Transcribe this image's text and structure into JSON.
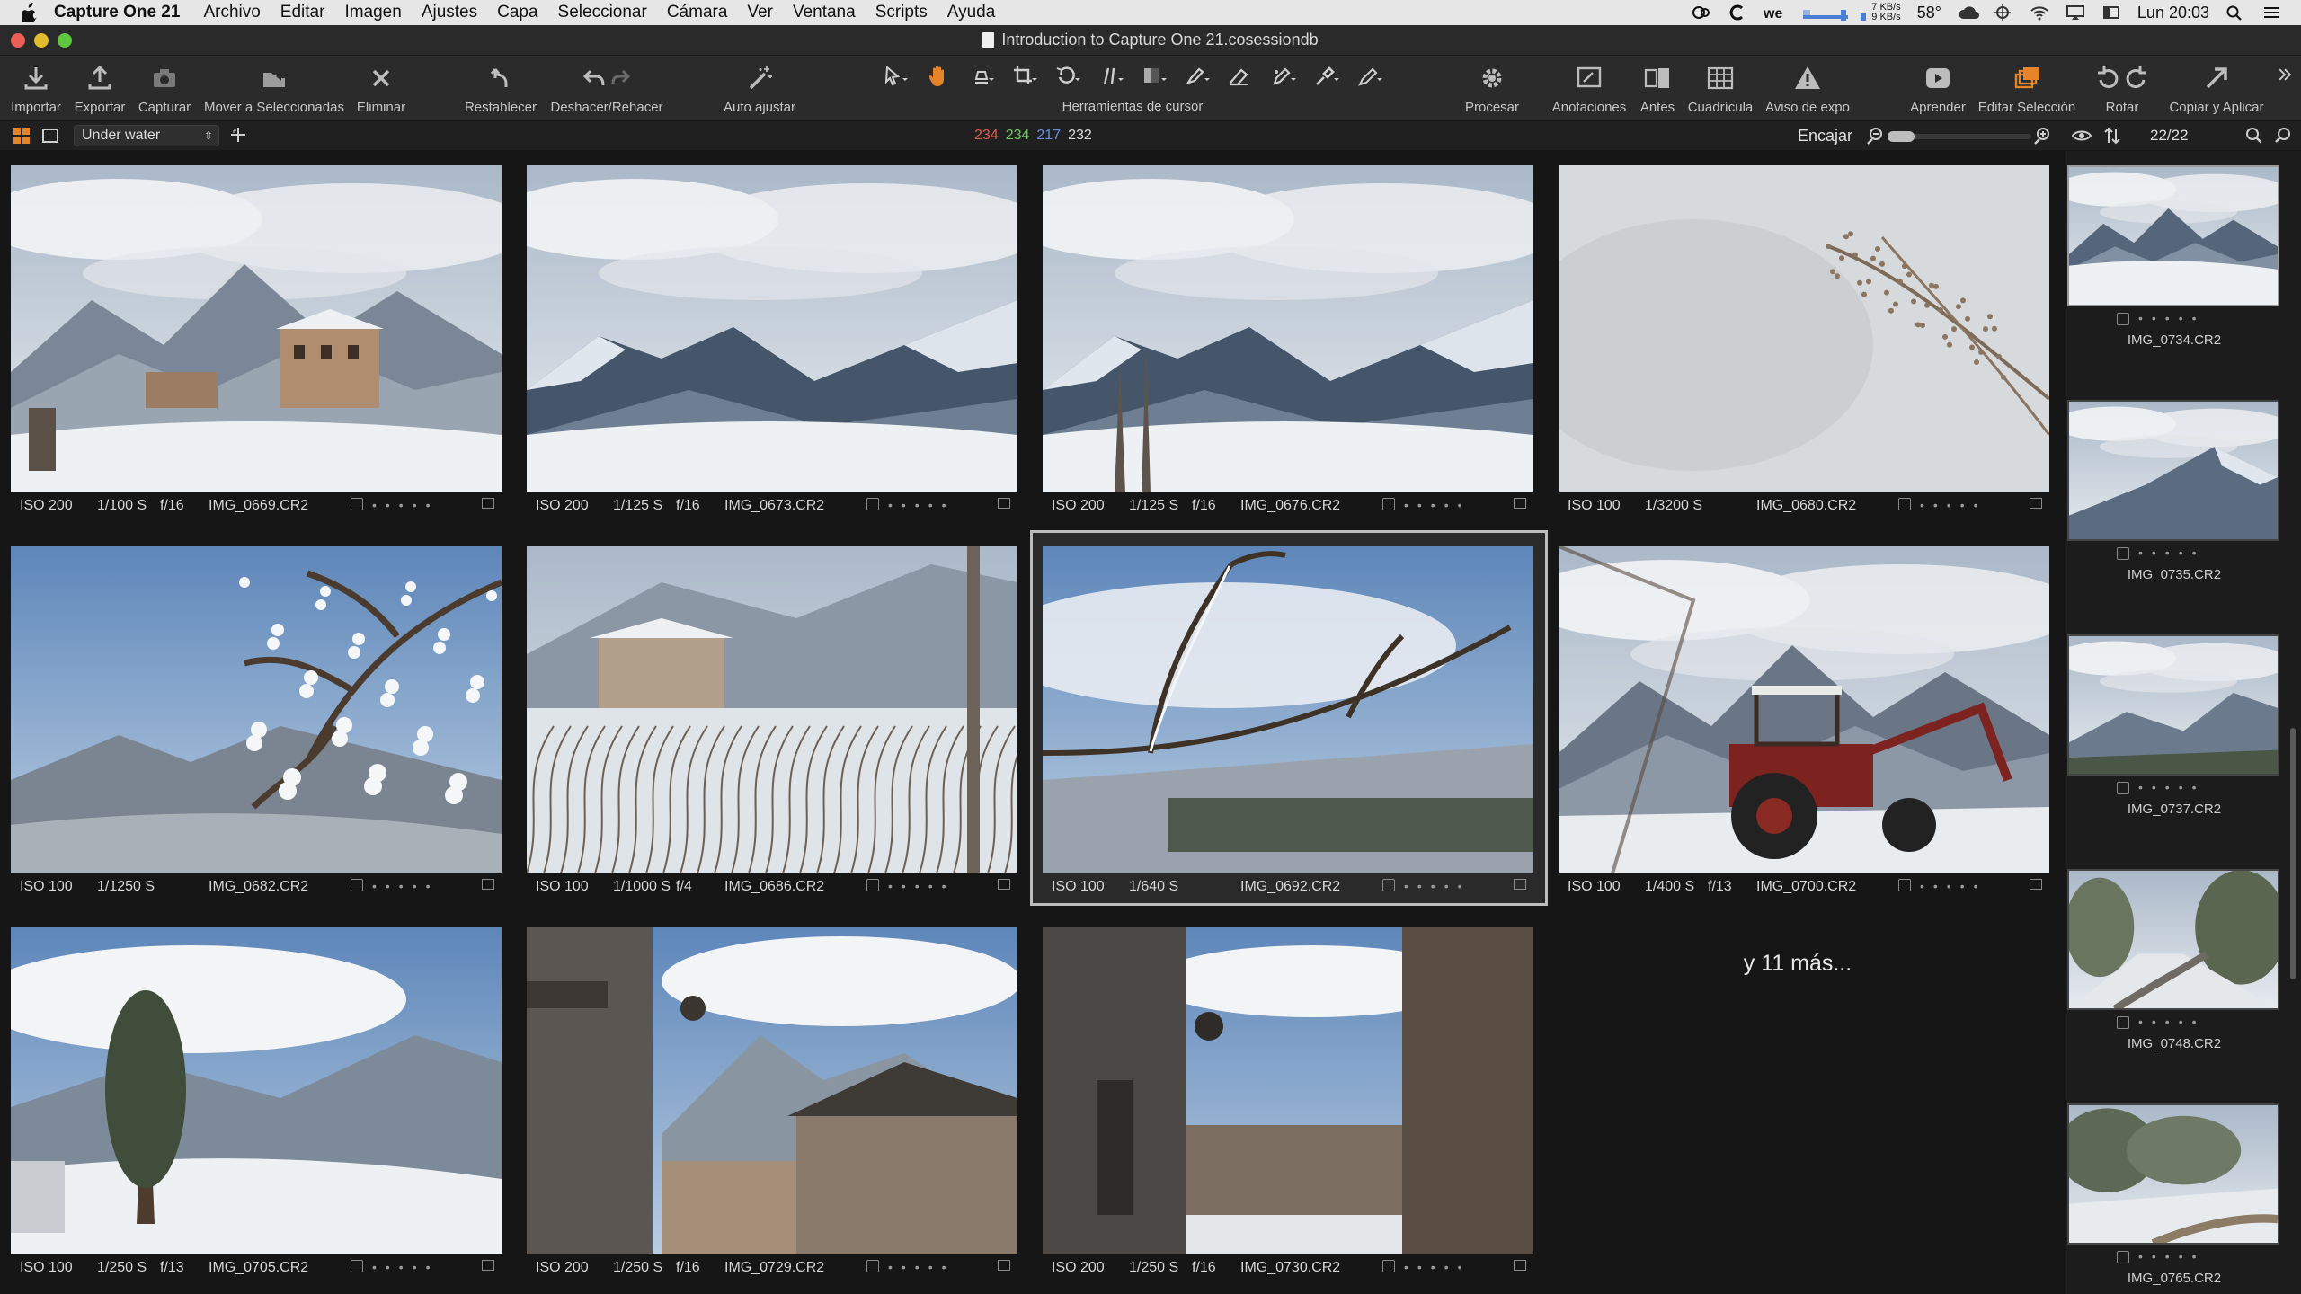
{
  "menubar": {
    "app": "Capture One 21",
    "items": [
      "Archivo",
      "Editar",
      "Imagen",
      "Ajustes",
      "Capa",
      "Seleccionar",
      "Cámara",
      "Ver",
      "Ventana",
      "Scripts",
      "Ayuda"
    ],
    "net_up": "7 KB/s",
    "net_down": "9 KB/s",
    "temp": "58°",
    "clock": "Lun 20:03"
  },
  "window": {
    "title": "Introduction to Capture One 21.cosessiondb"
  },
  "toolbar": {
    "import": "Importar",
    "export": "Exportar",
    "capture": "Capturar",
    "move": "Mover a Seleccionadas",
    "delete": "Eliminar",
    "reset": "Restablecer",
    "undo_redo": "Deshacer/Rehacer",
    "auto_adjust": "Auto ajustar",
    "cursor_tools": "Herramientas de cursor",
    "process": "Procesar",
    "annotations": "Anotaciones",
    "before": "Antes",
    "grid": "Cuadrícula",
    "exposure_warning": "Aviso de expo",
    "learn": "Aprender",
    "edit_selection": "Editar Selección",
    "rotate": "Rotar",
    "copy_apply": "Copiar y Aplicar"
  },
  "subbar": {
    "collection": "Under water",
    "rgb_r": "234",
    "rgb_g": "234",
    "rgb_b": "217",
    "rgb_l": "232",
    "fit": "Encajar",
    "count": "22/22"
  },
  "colors": {
    "r": "#e05a4e",
    "g": "#74c46a",
    "b": "#6a8fe0",
    "accent": "#e6842a"
  },
  "grid": {
    "items": [
      {
        "iso": "ISO 200",
        "shutter": "1/100 S",
        "aperture": "f/16",
        "name": "IMG_0669.CR2",
        "scene": "house"
      },
      {
        "iso": "ISO 200",
        "shutter": "1/125 S",
        "aperture": "f/16",
        "name": "IMG_0673.CR2",
        "scene": "mountains"
      },
      {
        "iso": "ISO 200",
        "shutter": "1/125 S",
        "aperture": "f/16",
        "name": "IMG_0676.CR2",
        "scene": "mountains2"
      },
      {
        "iso": "ISO 100",
        "shutter": "1/3200 S",
        "aperture": "",
        "name": "IMG_0680.CR2",
        "scene": "grass"
      },
      {
        "iso": "ISO 100",
        "shutter": "1/1250 S",
        "aperture": "",
        "name": "IMG_0682.CR2",
        "scene": "branch"
      },
      {
        "iso": "ISO 100",
        "shutter": "1/1000 S",
        "aperture": "f/4",
        "name": "IMG_0686.CR2",
        "scene": "bushes"
      },
      {
        "iso": "ISO 100",
        "shutter": "1/640 S",
        "aperture": "",
        "name": "IMG_0692.CR2",
        "scene": "twig"
      },
      {
        "iso": "ISO 100",
        "shutter": "1/400 S",
        "aperture": "f/13",
        "name": "IMG_0700.CR2",
        "scene": "tractor"
      },
      {
        "iso": "ISO 100",
        "shutter": "1/250 S",
        "aperture": "f/13",
        "name": "IMG_0705.CR2",
        "scene": "tree"
      },
      {
        "iso": "ISO 200",
        "shutter": "1/250 S",
        "aperture": "f/16",
        "name": "IMG_0729.CR2",
        "scene": "village"
      },
      {
        "iso": "ISO 200",
        "shutter": "1/250 S",
        "aperture": "f/16",
        "name": "IMG_0730.CR2",
        "scene": "alley"
      }
    ],
    "more_label": "y 11 más..."
  },
  "filmstrip": {
    "items": [
      {
        "name": "IMG_0734.CR2",
        "scene": "valley"
      },
      {
        "name": "IMG_0735.CR2",
        "scene": "peak"
      },
      {
        "name": "IMG_0737.CR2",
        "scene": "ridge"
      },
      {
        "name": "IMG_0748.CR2",
        "scene": "road"
      },
      {
        "name": "IMG_0765.CR2",
        "scene": "path"
      }
    ]
  }
}
